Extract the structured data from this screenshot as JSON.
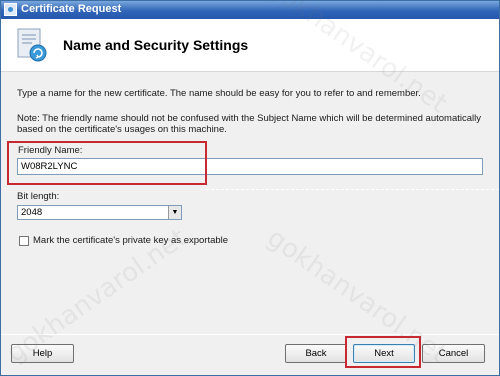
{
  "window": {
    "title": "Certificate Request",
    "icon": "certificate-icon"
  },
  "header": {
    "title": "Name and Security Settings",
    "icon": "certificate-refresh-icon"
  },
  "content": {
    "intro": "Type a name for the new certificate. The name should be easy for you to refer to and remember.",
    "note_line1": "Note: The friendly name should not be confused with the Subject Name which will be determined automatically",
    "note_line2": "based on the certificate's usages on this machine.",
    "friendly_name_label": "Friendly Name:",
    "friendly_name_value": "W08R2LYNC",
    "bit_length_label": "Bit length:",
    "bit_length_value": "2048",
    "exportable_label": "Mark the certificate's private key as exportable",
    "exportable_checked": false
  },
  "footer": {
    "help": "Help",
    "back": "Back",
    "next": "Next",
    "cancel": "Cancel"
  },
  "watermark_text": "gokhanvarol.net",
  "colors": {
    "highlight_box": "#c8282f",
    "titlebar": "#2f64b8"
  }
}
